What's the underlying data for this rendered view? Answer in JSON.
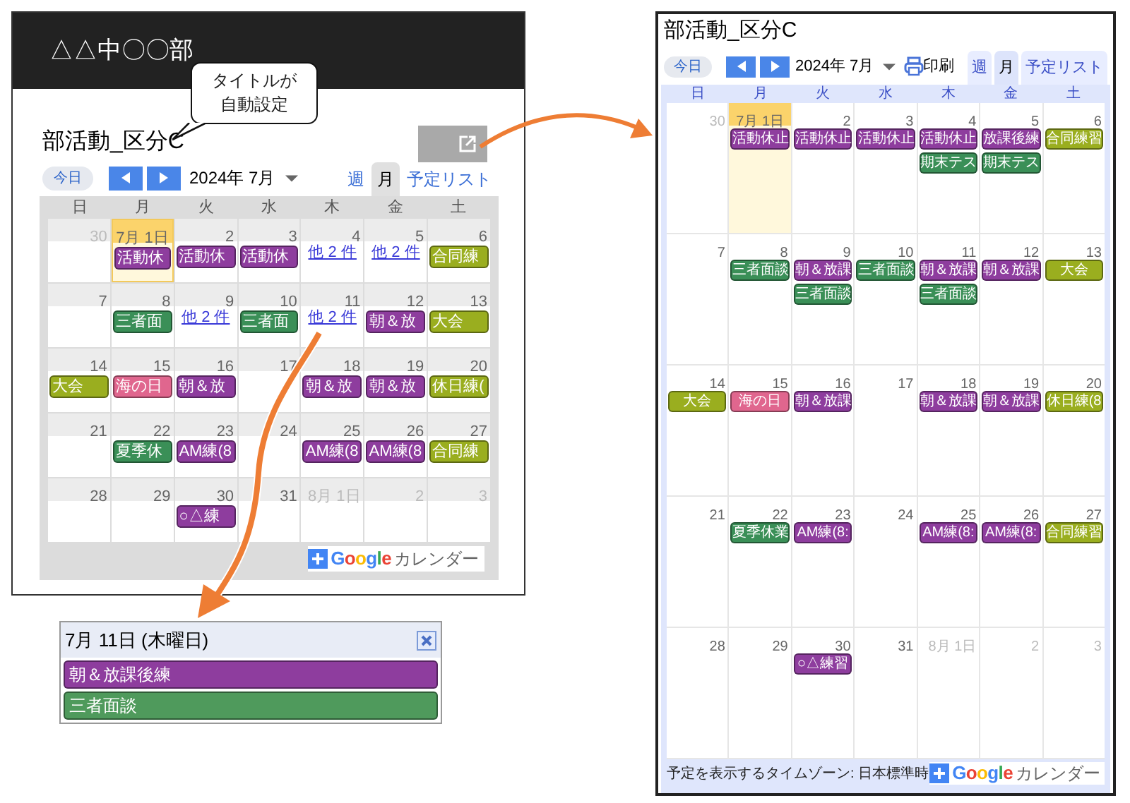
{
  "small_page": {
    "header_title": "△△中〇〇部",
    "callout_lines": [
      "タイトルが",
      "自動設定"
    ],
    "calendar": {
      "title": "部活動_区分C",
      "today_button": "今日",
      "month_label": "2024年 7月",
      "view_tabs": [
        {
          "label": "週",
          "selected": false
        },
        {
          "label": "月",
          "selected": true
        },
        {
          "label": "予定リスト",
          "selected": false
        }
      ],
      "weekdays": [
        "日",
        "月",
        "火",
        "水",
        "木",
        "金",
        "土"
      ],
      "weeks": [
        [
          {
            "date": "30",
            "other_month": true,
            "today": false
          },
          {
            "date": "7月 1日",
            "other_month": false,
            "today": true,
            "events": [
              {
                "label": "活動休",
                "color": "#8e3d9e"
              }
            ]
          },
          {
            "date": "2",
            "other_month": false,
            "today": false,
            "events": [
              {
                "label": "活動休",
                "color": "#8e3d9e"
              }
            ]
          },
          {
            "date": "3",
            "other_month": false,
            "today": false,
            "events": [
              {
                "label": "活動休",
                "color": "#8e3d9e"
              }
            ]
          },
          {
            "date": "4",
            "other_month": false,
            "today": false,
            "more": "他 2 件"
          },
          {
            "date": "5",
            "other_month": false,
            "today": false,
            "more": "他 2 件"
          },
          {
            "date": "6",
            "other_month": false,
            "today": false,
            "events": [
              {
                "label": "合同練",
                "color": "#9aae1f"
              }
            ]
          }
        ],
        [
          {
            "date": "7",
            "other_month": false,
            "today": false
          },
          {
            "date": "8",
            "other_month": false,
            "today": false,
            "events": [
              {
                "label": "三者面",
                "color": "#3a8f57"
              }
            ]
          },
          {
            "date": "9",
            "other_month": false,
            "today": false,
            "more": "他 2 件"
          },
          {
            "date": "10",
            "other_month": false,
            "today": false,
            "events": [
              {
                "label": "三者面",
                "color": "#3a8f57"
              }
            ]
          },
          {
            "date": "11",
            "other_month": false,
            "today": false,
            "more": "他 2 件"
          },
          {
            "date": "12",
            "other_month": false,
            "today": false,
            "events": [
              {
                "label": "朝＆放",
                "color": "#8e3d9e"
              }
            ]
          },
          {
            "date": "13",
            "other_month": false,
            "today": false,
            "events": [
              {
                "label": "大会",
                "color": "#9aae1f"
              }
            ]
          }
        ],
        [
          {
            "date": "14",
            "other_month": false,
            "today": false,
            "events": [
              {
                "label": "大会",
                "color": "#9aae1f"
              }
            ]
          },
          {
            "date": "15",
            "other_month": false,
            "today": false,
            "events": [
              {
                "label": "海の日",
                "color": "#e0668e"
              }
            ]
          },
          {
            "date": "16",
            "other_month": false,
            "today": false,
            "events": [
              {
                "label": "朝＆放",
                "color": "#8e3d9e"
              }
            ]
          },
          {
            "date": "17",
            "other_month": false,
            "today": false
          },
          {
            "date": "18",
            "other_month": false,
            "today": false,
            "events": [
              {
                "label": "朝＆放",
                "color": "#8e3d9e"
              }
            ]
          },
          {
            "date": "19",
            "other_month": false,
            "today": false,
            "events": [
              {
                "label": "朝＆放",
                "color": "#8e3d9e"
              }
            ]
          },
          {
            "date": "20",
            "other_month": false,
            "today": false,
            "events": [
              {
                "label": "休日練(",
                "color": "#9aae1f"
              }
            ]
          }
        ],
        [
          {
            "date": "21",
            "other_month": false,
            "today": false
          },
          {
            "date": "22",
            "other_month": false,
            "today": false,
            "events": [
              {
                "label": "夏季休",
                "color": "#3a8f57"
              }
            ]
          },
          {
            "date": "23",
            "other_month": false,
            "today": false,
            "events": [
              {
                "label": "AM練(8",
                "color": "#8e3d9e"
              }
            ]
          },
          {
            "date": "24",
            "other_month": false,
            "today": false
          },
          {
            "date": "25",
            "other_month": false,
            "today": false,
            "events": [
              {
                "label": "AM練(8",
                "color": "#8e3d9e"
              }
            ]
          },
          {
            "date": "26",
            "other_month": false,
            "today": false,
            "events": [
              {
                "label": "AM練(8",
                "color": "#8e3d9e"
              }
            ]
          },
          {
            "date": "27",
            "other_month": false,
            "today": false,
            "events": [
              {
                "label": "合同練",
                "color": "#9aae1f"
              }
            ]
          }
        ],
        [
          {
            "date": "28",
            "other_month": false,
            "today": false
          },
          {
            "date": "29",
            "other_month": false,
            "today": false
          },
          {
            "date": "30",
            "other_month": false,
            "today": false,
            "events": [
              {
                "label": "○△練",
                "color": "#8e3d9e"
              }
            ]
          },
          {
            "date": "31",
            "other_month": false,
            "today": false
          },
          {
            "date": "8月 1日",
            "other_month": true,
            "today": false
          },
          {
            "date": "2",
            "other_month": true,
            "today": false
          },
          {
            "date": "3",
            "other_month": true,
            "today": false
          }
        ]
      ],
      "badge": {
        "logo": "Google",
        "text": "カレンダー"
      }
    }
  },
  "popup": {
    "date": "7月 11日 (木曜日)",
    "events": [
      {
        "label": "朝＆放課後練",
        "color": "#8e3d9e"
      },
      {
        "label": "三者面談",
        "color": "#4f9a5c"
      }
    ]
  },
  "large_calendar": {
    "title": "部活動_区分C",
    "today_button": "今日",
    "month_label": "2024年 7月",
    "print_label": "印刷",
    "view_tabs": [
      {
        "label": "週",
        "selected": false
      },
      {
        "label": "月",
        "selected": true
      },
      {
        "label": "予定リスト",
        "selected": false
      }
    ],
    "weekdays": [
      "日",
      "月",
      "火",
      "水",
      "木",
      "金",
      "土"
    ],
    "weeks": [
      [
        {
          "date": "30",
          "other_month": true,
          "today": false
        },
        {
          "date": "7月 1日",
          "other_month": false,
          "today": true,
          "events": [
            {
              "label": "活動休止",
              "color": "#8e3d9e"
            }
          ]
        },
        {
          "date": "2",
          "other_month": false,
          "today": false,
          "events": [
            {
              "label": "活動休止",
              "color": "#8e3d9e"
            }
          ]
        },
        {
          "date": "3",
          "other_month": false,
          "today": false,
          "events": [
            {
              "label": "活動休止",
              "color": "#8e3d9e"
            }
          ]
        },
        {
          "date": "4",
          "other_month": false,
          "today": false,
          "events": [
            {
              "label": "活動休止",
              "color": "#8e3d9e"
            },
            {
              "label": "期末テス",
              "color": "#3a8f57"
            }
          ]
        },
        {
          "date": "5",
          "other_month": false,
          "today": false,
          "events": [
            {
              "label": "放課後練",
              "color": "#8e3d9e"
            },
            {
              "label": "期末テス",
              "color": "#3a8f57"
            }
          ]
        },
        {
          "date": "6",
          "other_month": false,
          "today": false,
          "events": [
            {
              "label": "合同練習",
              "color": "#9aae1f"
            }
          ]
        }
      ],
      [
        {
          "date": "7",
          "other_month": false,
          "today": false
        },
        {
          "date": "8",
          "other_month": false,
          "today": false,
          "events": [
            {
              "label": "三者面談",
              "color": "#3a8f57"
            }
          ]
        },
        {
          "date": "9",
          "other_month": false,
          "today": false,
          "events": [
            {
              "label": "朝＆放課",
              "color": "#8e3d9e"
            },
            {
              "label": "三者面談",
              "color": "#3a8f57"
            }
          ]
        },
        {
          "date": "10",
          "other_month": false,
          "today": false,
          "events": [
            {
              "label": "三者面談",
              "color": "#3a8f57"
            }
          ]
        },
        {
          "date": "11",
          "other_month": false,
          "today": false,
          "events": [
            {
              "label": "朝＆放課",
              "color": "#8e3d9e"
            },
            {
              "label": "三者面談",
              "color": "#3a8f57"
            }
          ]
        },
        {
          "date": "12",
          "other_month": false,
          "today": false,
          "events": [
            {
              "label": "朝＆放課",
              "color": "#8e3d9e"
            }
          ]
        },
        {
          "date": "13",
          "other_month": false,
          "today": false,
          "events": [
            {
              "label": "大会",
              "color": "#9aae1f"
            }
          ]
        }
      ],
      [
        {
          "date": "14",
          "other_month": false,
          "today": false,
          "events": [
            {
              "label": "大会",
              "color": "#9aae1f"
            }
          ]
        },
        {
          "date": "15",
          "other_month": false,
          "today": false,
          "events": [
            {
              "label": "海の日",
              "color": "#e0668e"
            }
          ]
        },
        {
          "date": "16",
          "other_month": false,
          "today": false,
          "events": [
            {
              "label": "朝＆放課",
              "color": "#8e3d9e"
            }
          ]
        },
        {
          "date": "17",
          "other_month": false,
          "today": false
        },
        {
          "date": "18",
          "other_month": false,
          "today": false,
          "events": [
            {
              "label": "朝＆放課",
              "color": "#8e3d9e"
            }
          ]
        },
        {
          "date": "19",
          "other_month": false,
          "today": false,
          "events": [
            {
              "label": "朝＆放課",
              "color": "#8e3d9e"
            }
          ]
        },
        {
          "date": "20",
          "other_month": false,
          "today": false,
          "events": [
            {
              "label": "休日練(8",
              "color": "#9aae1f"
            }
          ]
        }
      ],
      [
        {
          "date": "21",
          "other_month": false,
          "today": false
        },
        {
          "date": "22",
          "other_month": false,
          "today": false,
          "events": [
            {
              "label": "夏季休業",
              "color": "#3a8f57"
            }
          ]
        },
        {
          "date": "23",
          "other_month": false,
          "today": false,
          "events": [
            {
              "label": "AM練(8:",
              "color": "#8e3d9e"
            }
          ]
        },
        {
          "date": "24",
          "other_month": false,
          "today": false
        },
        {
          "date": "25",
          "other_month": false,
          "today": false,
          "events": [
            {
              "label": "AM練(8:",
              "color": "#8e3d9e"
            }
          ]
        },
        {
          "date": "26",
          "other_month": false,
          "today": false,
          "events": [
            {
              "label": "AM練(8:",
              "color": "#8e3d9e"
            }
          ]
        },
        {
          "date": "27",
          "other_month": false,
          "today": false,
          "events": [
            {
              "label": "合同練習",
              "color": "#9aae1f"
            }
          ]
        }
      ],
      [
        {
          "date": "28",
          "other_month": false,
          "today": false
        },
        {
          "date": "29",
          "other_month": false,
          "today": false
        },
        {
          "date": "30",
          "other_month": false,
          "today": false,
          "events": [
            {
              "label": "○△練習",
              "color": "#8e3d9e"
            }
          ]
        },
        {
          "date": "31",
          "other_month": false,
          "today": false
        },
        {
          "date": "8月 1日",
          "other_month": true,
          "today": false
        },
        {
          "date": "2",
          "other_month": true,
          "today": false
        },
        {
          "date": "3",
          "other_month": true,
          "today": false
        }
      ]
    ],
    "timezone": "予定を表示するタイムゾーン: 日本標準時",
    "badge": {
      "logo": "Google",
      "text": "カレンダー"
    }
  }
}
